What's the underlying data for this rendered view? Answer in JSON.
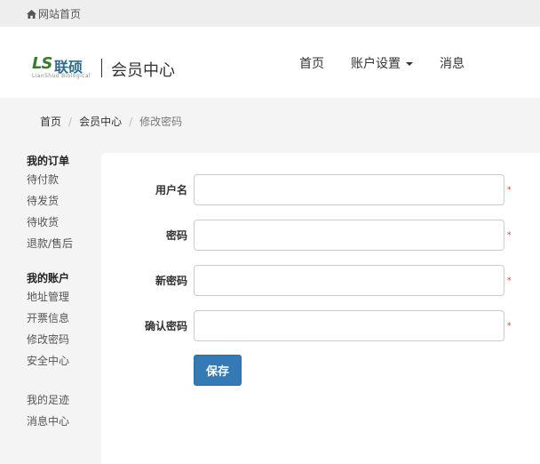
{
  "topbar": {
    "home_label": "网站首页"
  },
  "header": {
    "logo_mark": "LS",
    "logo_cn": "联硕",
    "logo_en": "LianShuo Biological",
    "title": "会员中心"
  },
  "nav": {
    "home": "首页",
    "account": "账户设置",
    "messages": "消息"
  },
  "breadcrumb": {
    "items": [
      "首页",
      "会员中心"
    ],
    "current": "修改密码",
    "separator": "/"
  },
  "sidebar": {
    "orders": {
      "heading": "我的订单",
      "items": [
        "待付款",
        "待发货",
        "待收货",
        "退款/售后"
      ]
    },
    "account": {
      "heading": "我的账户",
      "items": [
        "地址管理",
        "开票信息",
        "修改密码",
        "安全中心"
      ]
    },
    "misc": {
      "items": [
        "我的足迹",
        "消息中心"
      ]
    }
  },
  "form": {
    "fields": [
      {
        "label": "用户名",
        "value": "",
        "required_mark": "*"
      },
      {
        "label": "密码",
        "value": "",
        "required_mark": "*"
      },
      {
        "label": "新密码",
        "value": "",
        "required_mark": "*"
      },
      {
        "label": "确认密码",
        "value": "",
        "required_mark": "*"
      }
    ],
    "save_label": "保存"
  },
  "colors": {
    "primary": "#337ab7",
    "required": "#dd3333",
    "logo_green": "#3a7a2a",
    "logo_blue": "#2b6d8d"
  }
}
